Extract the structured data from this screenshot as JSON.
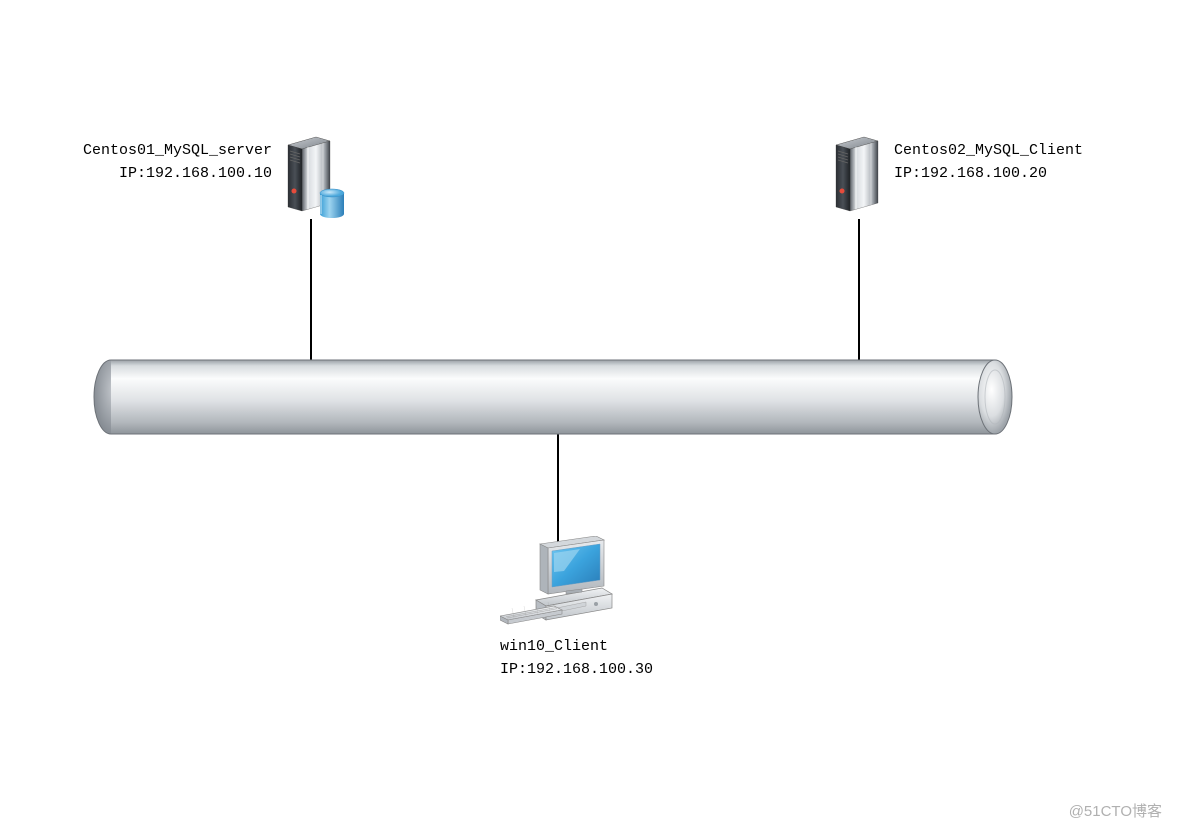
{
  "nodes": {
    "server_left": {
      "name_line": "Centos01_MySQL_server",
      "ip_line": "IP:192.168.100.10"
    },
    "server_right": {
      "name_line": "Centos02_MySQL_Client",
      "ip_line": "IP:192.168.100.20"
    },
    "client_bottom": {
      "name_line": "win10_Client",
      "ip_line": "IP:192.168.100.30"
    }
  },
  "watermark": "@51CTO博客"
}
